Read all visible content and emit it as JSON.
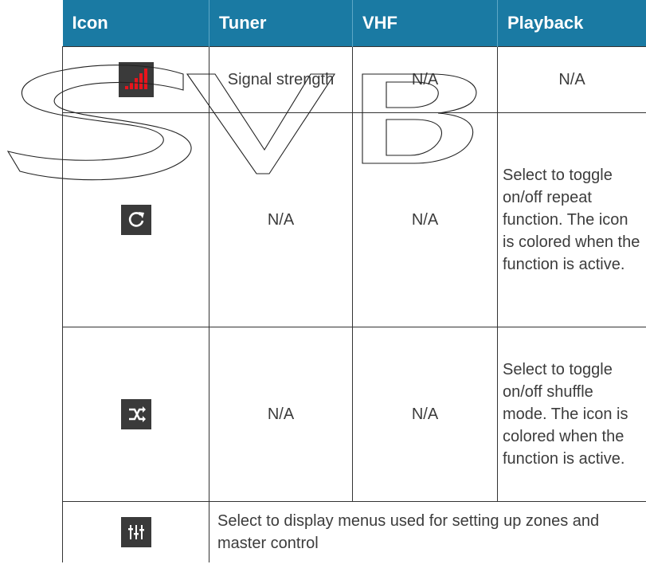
{
  "table": {
    "headers": [
      "Icon",
      "Tuner",
      "VHF",
      "Playback"
    ],
    "rows": [
      {
        "icon": "signal-strength-icon",
        "tuner": "Signal strength",
        "vhf": "N/A",
        "playback": "N/A"
      },
      {
        "icon": "repeat-icon",
        "tuner": "N/A",
        "vhf": "N/A",
        "playback": "Select to toggle on/off repeat function. The icon is colored when the function is active."
      },
      {
        "icon": "shuffle-icon",
        "tuner": "N/A",
        "vhf": "N/A",
        "playback": "Select to toggle on/off shuffle mode. The icon is colored when the function is active."
      },
      {
        "icon": "equalizer-icon",
        "span_text": "Select to display menus used for setting up zones and master control"
      }
    ]
  },
  "colors": {
    "header_bg": "#1a7aa3",
    "icon_bg": "#3a3a3a",
    "signal_red": "#e8141c"
  },
  "watermark": "SVB"
}
